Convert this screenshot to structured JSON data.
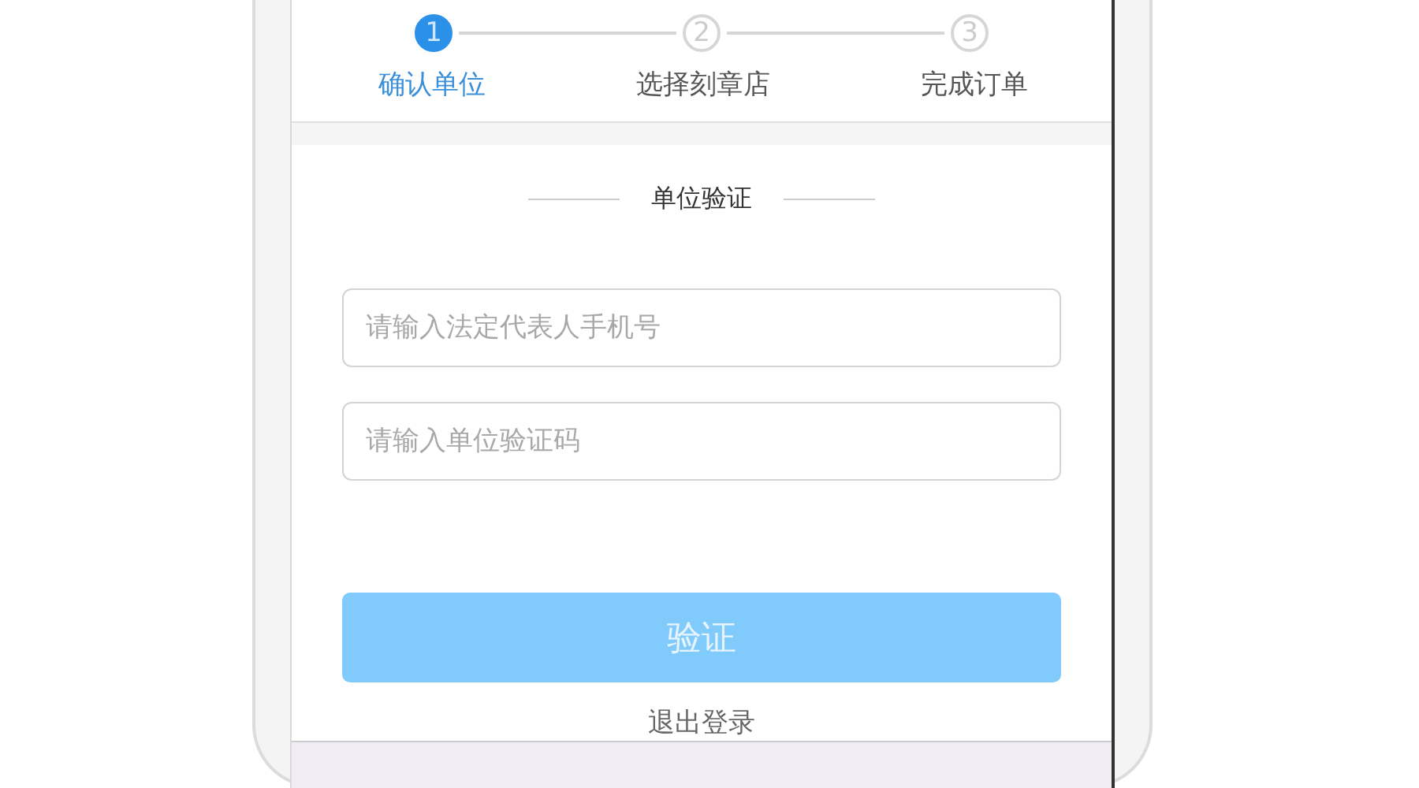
{
  "steps": [
    {
      "number": "1",
      "label": "确认单位",
      "selected": true
    },
    {
      "number": "2",
      "label": "选择刻章店",
      "selected": false
    },
    {
      "number": "3",
      "label": "完成订单",
      "selected": false
    }
  ],
  "section_title": "单位验证",
  "fields": [
    {
      "placeholder": "请输入法定代表人手机号"
    },
    {
      "placeholder": "请输入单位验证码"
    }
  ],
  "submit_button": {
    "label": "验证",
    "disabled": true
  },
  "logout_link": "退出登录"
}
